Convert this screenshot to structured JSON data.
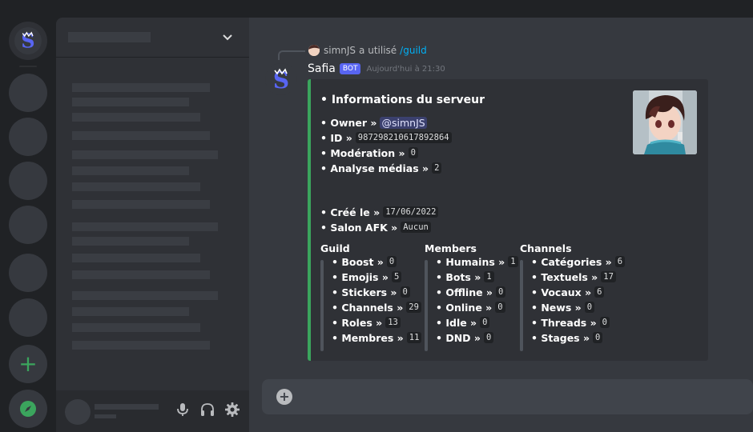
{
  "reply": {
    "user": "simnJS",
    "action": "a utilisé",
    "command": "/guild"
  },
  "message": {
    "author": "Safia",
    "bot_tag": "BOT",
    "timestamp": "Aujourd'hui à 21:30",
    "accent_color": "#3ba55d"
  },
  "embed": {
    "title": "• Informations du serveur",
    "owner": {
      "label": "• Owner »",
      "value": "@simnJS"
    },
    "id": {
      "label": "• ID »",
      "value": "987298210617892864"
    },
    "moderation": {
      "label": "• Modération »",
      "value": "0"
    },
    "media": {
      "label": "• Analyse médias »",
      "value": "2"
    },
    "created": {
      "label": "• Créé le »",
      "value": "17/06/2022"
    },
    "afk": {
      "label": "• Salon AFK »",
      "value": "Aucun"
    },
    "guild": {
      "title": "Guild",
      "items": [
        {
          "label": "• Boost »",
          "value": "0"
        },
        {
          "label": "• Emojis »",
          "value": "5"
        },
        {
          "label": "• Stickers »",
          "value": "0"
        },
        {
          "label": "• Channels »",
          "value": "29"
        },
        {
          "label": "• Roles »",
          "value": "13"
        },
        {
          "label": "• Membres »",
          "value": "11"
        }
      ]
    },
    "members": {
      "title": "Members",
      "items": [
        {
          "label": "• Humains »",
          "value": "1"
        },
        {
          "label": "• Bots »",
          "value": "1"
        },
        {
          "label": "• Offline »",
          "value": "0"
        },
        {
          "label": "• Online »",
          "value": "0"
        },
        {
          "label": "• Idle »",
          "value": "0"
        },
        {
          "label": "• DND »",
          "value": "0"
        }
      ]
    },
    "channels": {
      "title": "Channels",
      "items": [
        {
          "label": "• Catégories »",
          "value": "6"
        },
        {
          "label": "• Textuels »",
          "value": "17"
        },
        {
          "label": "• Vocaux »",
          "value": "6"
        },
        {
          "label": "• News »",
          "value": "0"
        },
        {
          "label": "• Threads »",
          "value": "0"
        },
        {
          "label": "• Stages »",
          "value": "0"
        }
      ]
    }
  },
  "icons": {
    "server_home": "safia-logo-icon",
    "add_server": "plus-icon",
    "explore": "compass-icon",
    "mic": "microphone-icon",
    "headphones": "headphones-icon",
    "settings": "gear-icon",
    "composer_add": "plus-circle-icon"
  }
}
